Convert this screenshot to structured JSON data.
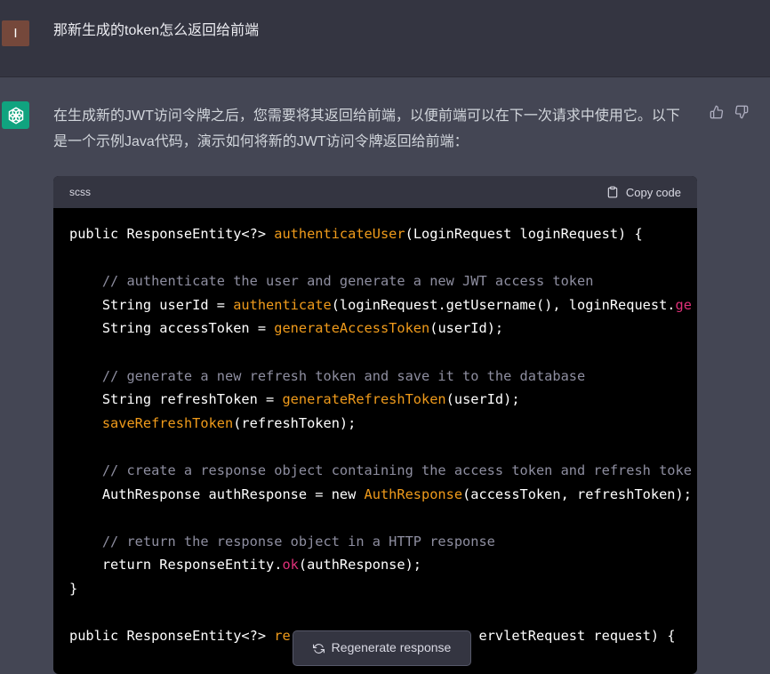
{
  "user_message": {
    "avatar_letter": "I",
    "text": "那新生成的token怎么返回给前端"
  },
  "assistant_message": {
    "text": "在生成新的JWT访问令牌之后，您需要将其返回给前端，以便前端可以在下一次请求中使用它。以下是一个示例Java代码，演示如何将新的JWT访问令牌返回给前端：",
    "icons": [
      "openai-logo-icon",
      "thumbs-up-icon",
      "thumbs-down-icon"
    ]
  },
  "code_block": {
    "language": "scss",
    "copy_label": "Copy code",
    "lines": [
      [
        {
          "t": "public ResponseEntity<?> ",
          "c": "plain"
        },
        {
          "t": "authenticateUser",
          "c": "fn"
        },
        {
          "t": "(LoginRequest loginRequest) {",
          "c": "plain"
        }
      ],
      [],
      [
        {
          "t": "    // authenticate the user and generate a new JWT access token",
          "c": "cm"
        }
      ],
      [
        {
          "t": "    String userId = ",
          "c": "plain"
        },
        {
          "t": "authenticate",
          "c": "fn"
        },
        {
          "t": "(loginRequest.getUsername(), loginRequest.",
          "c": "plain"
        },
        {
          "t": "ge",
          "c": "red"
        }
      ],
      [
        {
          "t": "    String accessToken = ",
          "c": "plain"
        },
        {
          "t": "generateAccessToken",
          "c": "fn"
        },
        {
          "t": "(userId);",
          "c": "plain"
        }
      ],
      [],
      [
        {
          "t": "    // generate a new refresh token and save it to the database",
          "c": "cm"
        }
      ],
      [
        {
          "t": "    String refreshToken = ",
          "c": "plain"
        },
        {
          "t": "generateRefreshToken",
          "c": "fn"
        },
        {
          "t": "(userId);",
          "c": "plain"
        }
      ],
      [
        {
          "t": "    ",
          "c": "plain"
        },
        {
          "t": "saveRefreshToken",
          "c": "fn"
        },
        {
          "t": "(refreshToken);",
          "c": "plain"
        }
      ],
      [],
      [
        {
          "t": "    // create a response object containing the access token and refresh toke",
          "c": "cm"
        }
      ],
      [
        {
          "t": "    AuthResponse authResponse = new ",
          "c": "plain"
        },
        {
          "t": "AuthResponse",
          "c": "fn"
        },
        {
          "t": "(accessToken, refreshToken);",
          "c": "plain"
        }
      ],
      [],
      [
        {
          "t": "    // return the response object in a HTTP response",
          "c": "cm"
        }
      ],
      [
        {
          "t": "    return ResponseEntity.",
          "c": "plain"
        },
        {
          "t": "ok",
          "c": "red"
        },
        {
          "t": "(authResponse);",
          "c": "plain"
        }
      ],
      [
        {
          "t": "}",
          "c": "plain"
        }
      ],
      [],
      [
        {
          "t": "public ResponseEntity<?> ",
          "c": "plain"
        },
        {
          "t": "re",
          "c": "fn"
        },
        {
          "t": "                       ",
          "c": "plain"
        },
        {
          "t": "ervletRequest request) {",
          "c": "plain"
        }
      ]
    ]
  },
  "regenerate": {
    "label": "Regenerate response"
  },
  "colors": {
    "user_bg": "#343541",
    "assistant_bg": "#444654",
    "accent": "#10a37f",
    "code_function": "#f09b1b",
    "code_comment": "#8e8ea0",
    "code_red": "#df3079"
  }
}
